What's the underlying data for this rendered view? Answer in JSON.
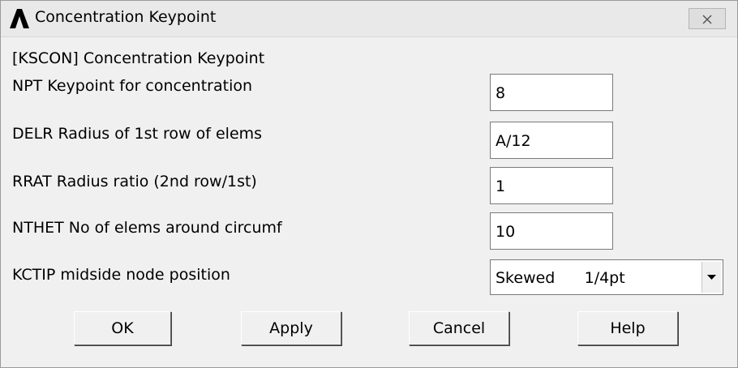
{
  "window": {
    "title": "Concentration Keypoint",
    "app_icon": "ansys-logo-icon",
    "close_icon": "close-icon"
  },
  "command_label": "[KSCON]  Concentration Keypoint",
  "fields": [
    {
      "label": "NPT   Keypoint for concentration",
      "value": "8"
    },
    {
      "label": "DELR  Radius of 1st row of elems",
      "value": "A/12"
    },
    {
      "label": "RRAT  Radius ratio (2nd row/1st)",
      "value": "1"
    },
    {
      "label": "NTHET No of elems around circumf",
      "value": "10"
    }
  ],
  "kctip": {
    "label": "KCTIP midside node position",
    "selected": "Skewed      1/4pt",
    "dropdown_icon": "chevron-down-icon"
  },
  "buttons": {
    "ok": "OK",
    "apply": "Apply",
    "cancel": "Cancel",
    "help": "Help"
  }
}
